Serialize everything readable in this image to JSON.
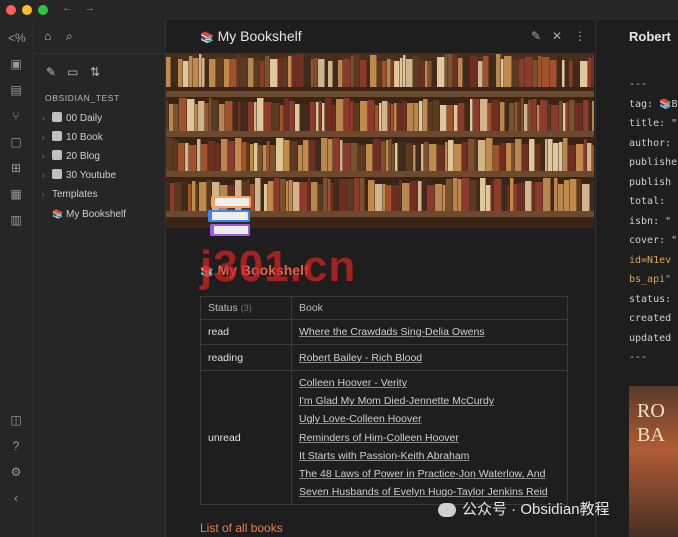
{
  "window": {
    "nav_back": "←",
    "nav_forward": "→"
  },
  "ribbon": {
    "icons": [
      "code-icon",
      "terminal-icon",
      "file-icon",
      "graph-icon",
      "command-icon",
      "blocks-icon",
      "calendar-icon",
      "book-icon",
      "help-circle-icon",
      "question-icon",
      "settings-icon",
      "collapse-icon"
    ]
  },
  "sidebar": {
    "vault_name": "OBSIDIAN_TEST",
    "items": [
      {
        "label": "00 Daily",
        "icon": "calendar-folder-icon",
        "has_chevron": true
      },
      {
        "label": "10 Book",
        "icon": "book-folder-icon",
        "has_chevron": true
      },
      {
        "label": "20 Blog",
        "icon": "blog-folder-icon",
        "has_chevron": true
      },
      {
        "label": "30 Youtube",
        "icon": "youtube-folder-icon",
        "has_chevron": true
      },
      {
        "label": "Templates",
        "icon": "",
        "has_chevron": true
      },
      {
        "label": "My Bookshelf",
        "icon": "books-emoji-icon",
        "has_chevron": false
      }
    ]
  },
  "main": {
    "tab_title": "My Bookshelf",
    "heading": "My Bookshelf",
    "table": {
      "col_status": "Status",
      "col_status_count": "(3)",
      "col_book": "Book",
      "rows": [
        {
          "status": "read",
          "books": [
            "Where the Crawdads Sing-Delia Owens"
          ]
        },
        {
          "status": "reading",
          "books": [
            "Robert Bailey - Rich Blood"
          ]
        },
        {
          "status": "unread",
          "books": [
            "Colleen Hoover - Verity",
            "I'm Glad My Mom Died-Jennette McCurdy",
            "Ugly Love-Colleen Hoover",
            "Reminders of Him-Colleen Hoover",
            "It Starts with Passion-Keith Abraham",
            "The 48 Laws of Power in Practice-Jon Waterlow, And",
            "Seven Husbands of Evelyn Hugo-Taylor Jenkins Reid"
          ]
        }
      ]
    },
    "list_all": "List of all books"
  },
  "right_pane": {
    "title": "Robert",
    "code_lines": [
      "---",
      "tag: 📚B",
      "title: \"",
      "author:",
      "publishe",
      "publish",
      "total: ",
      "isbn: \"",
      "cover: \"",
      "id=N1ev",
      "bs_api\"",
      "status:",
      "created",
      "updated",
      "---"
    ],
    "cover_text": [
      "RO",
      "BA"
    ]
  },
  "watermark": "j301.cn",
  "wechat": "公众号 · Obsidian教程",
  "colors": {
    "heading": "#e8624f",
    "list_all": "#e8824f",
    "watermark": "#d62323"
  }
}
